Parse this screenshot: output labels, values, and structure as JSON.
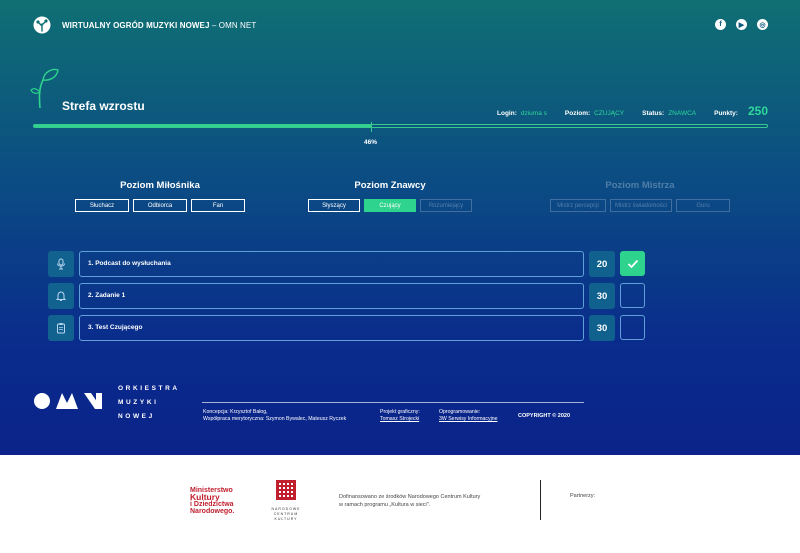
{
  "header": {
    "title_bold": "WIRTUALNY OGRÓD MUZYKI NOWEJ",
    "title_thin": " – OMN NET",
    "socials": [
      {
        "icon": "facebook-icon",
        "glyph": "f"
      },
      {
        "icon": "youtube-icon",
        "glyph": "▶"
      },
      {
        "icon": "instagram-icon",
        "glyph": "◎"
      }
    ]
  },
  "status": {
    "zone_title": "Strefa wzrostu",
    "login_label": "Login:",
    "login_value": "dziuma s",
    "level_label": "Poziom:",
    "level_value": "CZUJĄCY",
    "status_label": "Status:",
    "status_value": "ZNAWCA",
    "points_label": "Punkty:",
    "points_value": "250",
    "progress": 0.46,
    "progress_label": "46%"
  },
  "levels": [
    {
      "title": "Poziom Miłośnika",
      "dim": false,
      "chips": [
        {
          "label": "Słuchacz",
          "state": "normal"
        },
        {
          "label": "Odbiorca",
          "state": "normal"
        },
        {
          "label": "Fan",
          "state": "normal"
        }
      ]
    },
    {
      "title": "Poziom Znawcy",
      "dim": false,
      "chips": [
        {
          "label": "Słyszący",
          "state": "normal"
        },
        {
          "label": "Czujący",
          "state": "active"
        },
        {
          "label": "Rozumiejący",
          "state": "dim"
        }
      ]
    },
    {
      "title": "Poziom Mistrza",
      "dim": true,
      "chips": [
        {
          "label": "Mistrz percepcji",
          "state": "dim"
        },
        {
          "label": "Mistrz świadomości",
          "state": "dim"
        },
        {
          "label": "Guru",
          "state": "dim"
        }
      ]
    }
  ],
  "tasks": [
    {
      "icon": "microphone-icon",
      "label": "1. Podcast do wysłuchania",
      "points": "20",
      "done": true
    },
    {
      "icon": "bell-icon",
      "label": "2. Zadanie 1",
      "points": "30",
      "done": false
    },
    {
      "icon": "clipboard-icon",
      "label": "3. Test Czującego",
      "points": "30",
      "done": false
    }
  ],
  "footer": {
    "omn_lines": [
      "ORKIESTRA",
      "MUZYKI",
      "NOWEJ"
    ],
    "concept_line1": "Koncepcja: Krzysztof Bałog,",
    "concept_line2": "Współpraca merytoryczna: Szymon Bywalec, Mateusz Ryczek",
    "design_label": "Projekt graficzny:",
    "design_value": "Tomasz Strojecki",
    "software_label": "Oprogramowanie:",
    "software_value": "3W Serwisy Informacyjne",
    "copyright": "COPYRIGHT © 2020"
  },
  "sponsors": {
    "ministry_line1": "Ministerstwo",
    "ministry_line2": "Kultury",
    "ministry_line3": "i Dziedzictwa",
    "ministry_line4": "Narodowego.",
    "nck_text": "NARODOWE CENTRUM KULTURY",
    "fund_line1": "Dofinansowano ze środków Narodowego Centrum Kultury",
    "fund_line2": "w ramach programu „Kultura w sieci\".",
    "partners_label": "Partnerzy:"
  },
  "colors": {
    "accent": "#2ed38d",
    "bg_top": "#0f6f73",
    "bg_bottom": "#0b238a",
    "ministry_red": "#c01f2e"
  }
}
